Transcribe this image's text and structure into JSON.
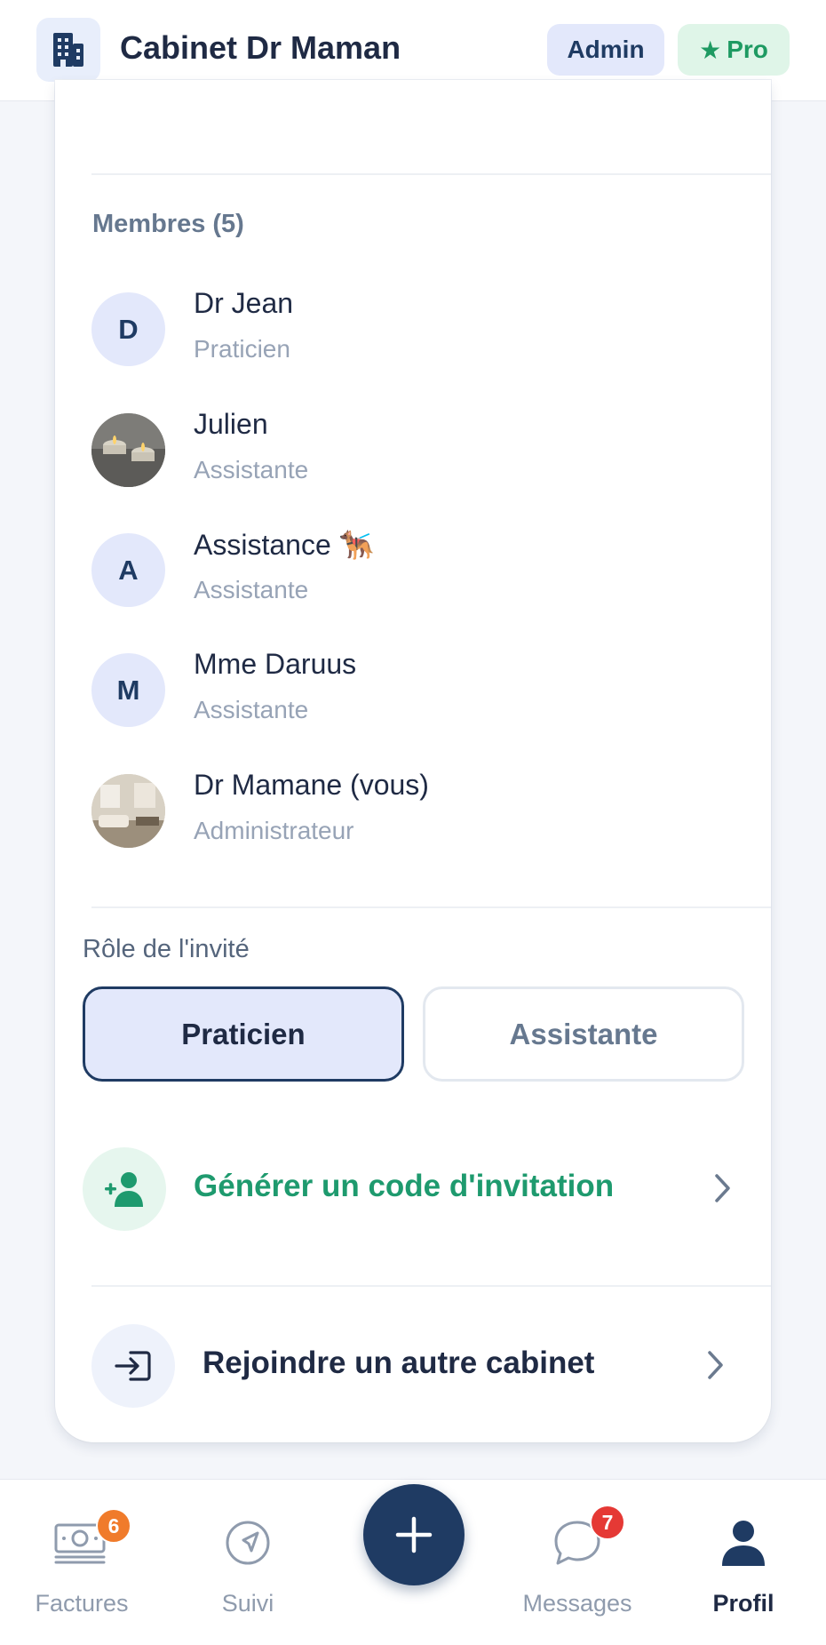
{
  "header": {
    "title": "Cabinet Dr Maman",
    "building_icon": "building-icon",
    "badges": {
      "admin": "Admin",
      "pro_star": "★",
      "pro": "Pro"
    }
  },
  "members": {
    "title": "Membres (5)",
    "items": [
      {
        "initial": "D",
        "name": "Dr Jean",
        "role": "Praticien",
        "avatar": "initial"
      },
      {
        "initial": "",
        "name": "Julien",
        "role": "Assistante",
        "avatar": "photo-candles"
      },
      {
        "initial": "A",
        "name": "Assistance 🐕‍🦺",
        "role": "Assistante",
        "avatar": "initial"
      },
      {
        "initial": "M",
        "name": "Mme Daruus",
        "role": "Assistante",
        "avatar": "initial"
      },
      {
        "initial": "",
        "name": "Dr Mamane (vous)",
        "role": "Administrateur",
        "avatar": "photo-room"
      }
    ]
  },
  "invite": {
    "label": "Rôle de l'invité",
    "options": [
      {
        "label": "Praticien",
        "selected": true
      },
      {
        "label": "Assistante",
        "selected": false
      }
    ]
  },
  "actions": {
    "generate": {
      "label": "Générer un code d'invitation",
      "icon": "add-user-icon",
      "color": "#1e9a6e"
    },
    "join": {
      "label": "Rejoindre un autre cabinet",
      "icon": "login-icon",
      "color": "#1f2a44"
    }
  },
  "bottom_nav": {
    "items": [
      {
        "label": "Factures",
        "icon": "cash-icon",
        "badge": "6",
        "badge_color": "#f07b2b"
      },
      {
        "label": "Suivi",
        "icon": "navigation-icon"
      },
      {
        "label": "Messages",
        "icon": "chat-bubble-icon",
        "badge": "7",
        "badge_color": "#e53935"
      },
      {
        "label": "Profil",
        "icon": "person-icon",
        "active": true
      }
    ],
    "fab_icon": "plus-icon"
  }
}
